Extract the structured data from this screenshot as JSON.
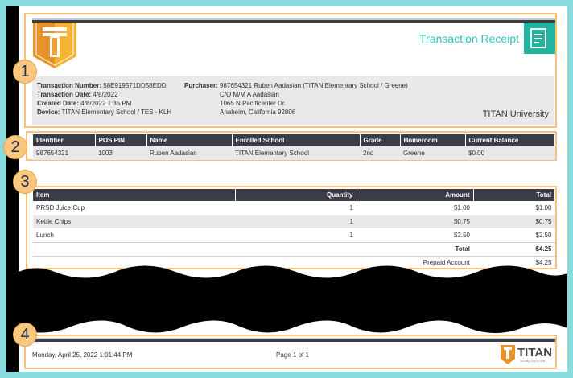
{
  "header": {
    "title": "Transaction Receipt",
    "org": "TITAN University"
  },
  "transaction": {
    "number_label": "Transaction Number:",
    "number": "58E919571DD58EDD",
    "date_label": "Transaction Date:",
    "date": "4/8/2022",
    "created_label": "Created Date:",
    "created": "4/8/2022 1:35 PM",
    "device_label": "Device:",
    "device": "TITAN Elementary School / TES - KLH",
    "purchaser_label": "Purchaser:",
    "purchaser": "987654321 Ruben Aadasian (TITAN Elementary School / Greene)",
    "address": [
      "C/O M/M A Aadasian",
      "1065 N Pacificenter Dr.",
      "Anaheim, California 92806"
    ]
  },
  "student": {
    "headers": [
      "Identifier",
      "POS PIN",
      "Name",
      "Enrolled School",
      "Grade",
      "Homeroom",
      "Current Balance"
    ],
    "row": [
      "987654321",
      "1003",
      "Ruben Aadasian",
      "TITAN Elementary School",
      "2nd",
      "Greene",
      "$0.00"
    ]
  },
  "items": {
    "headers": [
      "Item",
      "Quantity",
      "Amount",
      "Total"
    ],
    "rows": [
      [
        "PRSD Juice Cup",
        "1",
        "$1.00",
        "$1.00"
      ],
      [
        "Kettle Chips",
        "1",
        "$0.75",
        "$0.75"
      ],
      [
        "Lunch",
        "1",
        "$2.50",
        "$2.50"
      ]
    ],
    "total_label": "Total",
    "total": "$4.25",
    "payment_label": "Prepaid Account",
    "payment": "$4.25"
  },
  "footer": {
    "datetime": "Monday, April 25, 2022 1:01:44 PM",
    "page": "Page 1 of 1",
    "logo_text": "TITAN",
    "logo_sub": "A LINQ SOLUTION"
  },
  "badges": [
    "1",
    "2",
    "3",
    "4"
  ],
  "colors": {
    "teal": "#1fb5a0",
    "orange": "#f2a532",
    "highlight": "#f9c27a",
    "dark": "#3a3d45"
  }
}
